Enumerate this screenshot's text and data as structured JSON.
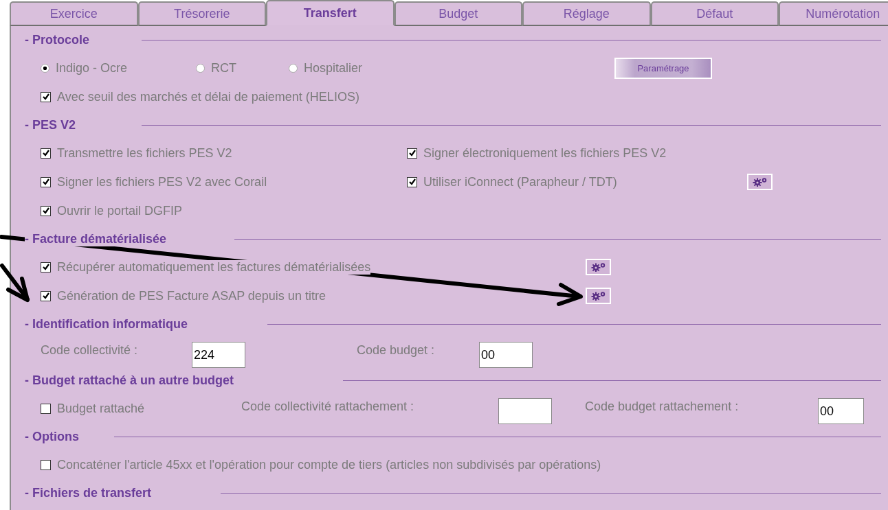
{
  "tabs": [
    {
      "label": "Exercice",
      "selected": false
    },
    {
      "label": "Trésorerie",
      "selected": false
    },
    {
      "label": "Transfert",
      "selected": true
    },
    {
      "label": "Budget",
      "selected": false
    },
    {
      "label": "Réglage",
      "selected": false
    },
    {
      "label": "Défaut",
      "selected": false
    },
    {
      "label": "Numérotation",
      "selected": false
    }
  ],
  "sections": [
    {
      "title": "- Protocole",
      "rows": [
        {
          "items": [
            {
              "kind": "radio",
              "label": "Indigo - Ocre",
              "selected": true
            },
            {
              "kind": "radio",
              "label": "RCT",
              "selected": false
            },
            {
              "kind": "radio",
              "label": "Hospitalier",
              "selected": false
            },
            {
              "kind": "button",
              "label": "Paramétrage"
            }
          ]
        },
        {
          "items": [
            {
              "kind": "checkbox",
              "label": "Avec seuil des marchés et délai de paiement (HELIOS)",
              "checked": true
            }
          ]
        }
      ]
    },
    {
      "title": "- PES V2",
      "rows": [
        {
          "items": [
            {
              "kind": "checkbox",
              "label": "Transmettre les fichiers PES V2",
              "checked": true
            },
            {
              "kind": "checkbox",
              "label": "Signer électroniquement les fichiers PES V2",
              "checked": true
            }
          ]
        },
        {
          "items": [
            {
              "kind": "checkbox",
              "label": "Signer les fichiers PES V2 avec Corail",
              "checked": true
            },
            {
              "kind": "checkbox",
              "label": "Utiliser iConnect (Parapheur / TDT)",
              "checked": true
            },
            {
              "kind": "gear"
            }
          ]
        },
        {
          "items": [
            {
              "kind": "checkbox",
              "label": "Ouvrir le portail DGFIP",
              "checked": true
            }
          ]
        }
      ]
    },
    {
      "title": "- Facture dématérialisée",
      "rows": [
        {
          "items": [
            {
              "kind": "checkbox",
              "label": "Récupérer automatiquement les factures dématérialisées",
              "checked": true
            },
            {
              "kind": "gear"
            }
          ]
        },
        {
          "items": [
            {
              "kind": "checkbox",
              "label": "Génération de PES Facture ASAP depuis un titre",
              "checked": true
            },
            {
              "kind": "gear"
            }
          ]
        }
      ]
    },
    {
      "title": "- Identification informatique",
      "rows": [
        {
          "items": [
            {
              "kind": "label",
              "label": "Code collectivité :"
            },
            {
              "kind": "field",
              "value": "224"
            },
            {
              "kind": "label",
              "label": "Code budget :"
            },
            {
              "kind": "field",
              "value": "00"
            }
          ]
        }
      ]
    },
    {
      "title": "- Budget rattaché à un autre budget",
      "rows": [
        {
          "items": [
            {
              "kind": "checkbox",
              "label": "Budget rattaché",
              "checked": false
            },
            {
              "kind": "label",
              "label": "Code collectivité rattachement :"
            },
            {
              "kind": "field"
            },
            {
              "kind": "label",
              "label": "Code budget rattachement :"
            },
            {
              "kind": "field",
              "value": "00"
            }
          ]
        }
      ]
    },
    {
      "title": "- Options",
      "rows": [
        {
          "items": [
            {
              "kind": "checkbox",
              "label": "Concaténer l'article 45xx et l'opération pour compte de tiers (articles non subdivisés par opérations)",
              "checked": false
            }
          ]
        }
      ]
    },
    {
      "title": "- Fichiers de transfert"
    }
  ]
}
